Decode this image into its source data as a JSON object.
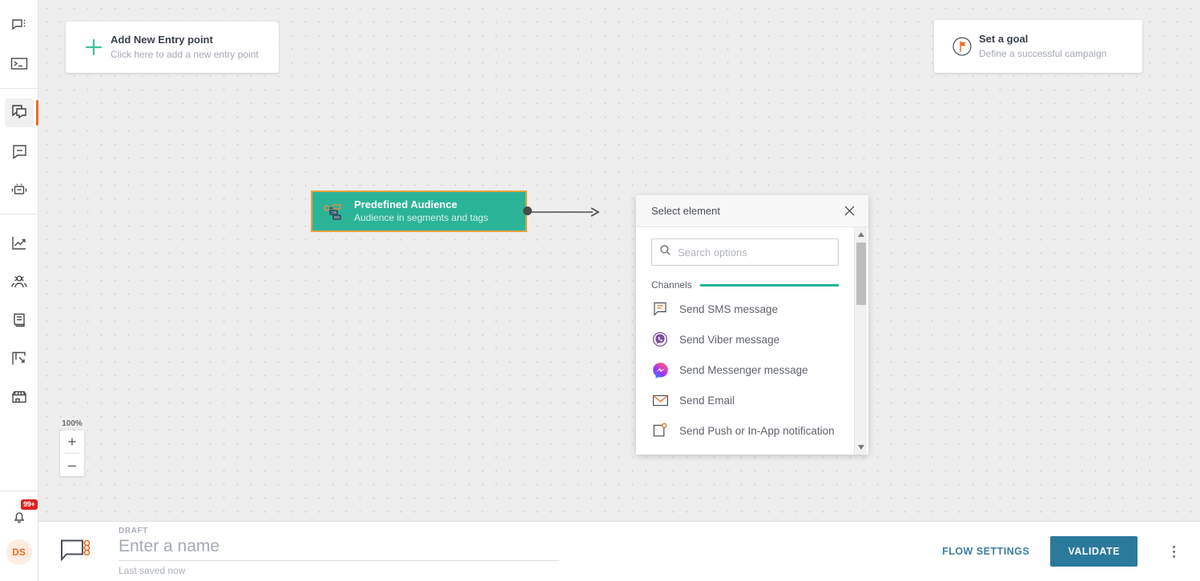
{
  "sidebar": {
    "groups": [
      {
        "items": [
          {
            "name": "chat-menu-icon",
            "icon": "chat-menu"
          },
          {
            "name": "terminal-icon",
            "icon": "terminal"
          }
        ]
      },
      {
        "items": [
          {
            "name": "flows-icon",
            "icon": "flows",
            "active": true
          },
          {
            "name": "templates-icon",
            "icon": "templates"
          },
          {
            "name": "bot-icon",
            "icon": "bot"
          }
        ]
      },
      {
        "items": [
          {
            "name": "analytics-icon",
            "icon": "analytics"
          },
          {
            "name": "audience-icon",
            "icon": "audience"
          },
          {
            "name": "content-icon",
            "icon": "content"
          },
          {
            "name": "pages-icon",
            "icon": "pages"
          },
          {
            "name": "store-icon",
            "icon": "store"
          }
        ]
      }
    ],
    "notifications": {
      "badge": "99+",
      "icon": "bell-icon"
    },
    "avatar_initials": "DS"
  },
  "canvas": {
    "entry_card": {
      "title": "Add New Entry point",
      "subtitle": "Click here to add a new entry point",
      "icon": "plus-icon"
    },
    "goal_card": {
      "title": "Set a goal",
      "subtitle": "Define a successful campaign",
      "icon": "flag-circle-icon"
    },
    "node": {
      "title": "Predefined Audience",
      "subtitle": "Audience in segments and tags",
      "icon": "audience-segments-icon"
    },
    "zoom": {
      "level": "100%",
      "zoom_in_label": "+",
      "zoom_out_label": "–"
    }
  },
  "panel": {
    "title": "Select element",
    "close_icon": "close-icon",
    "search": {
      "placeholder": "Search options",
      "value": "",
      "icon": "search-icon"
    },
    "section": {
      "label": "Channels",
      "accent": "#1db698"
    },
    "options": [
      {
        "label": "Send SMS message",
        "icon": "sms-icon"
      },
      {
        "label": "Send Viber message",
        "icon": "viber-icon"
      },
      {
        "label": "Send Messenger message",
        "icon": "messenger-icon"
      },
      {
        "label": "Send Email",
        "icon": "email-icon"
      },
      {
        "label": "Send Push or In-App notification",
        "icon": "push-icon"
      }
    ]
  },
  "bottom": {
    "flow_icon": "flow-icon",
    "status": "DRAFT",
    "name_placeholder": "Enter a name",
    "name_value": "",
    "saved_label": "Last saved now",
    "flow_settings_label": "FLOW SETTINGS",
    "validate_label": "VALIDATE",
    "more_icon": "kebab-menu-icon"
  },
  "colors": {
    "node_green": "#2bb498",
    "node_border": "#e8a33d",
    "accent_orange": "#ee6c23",
    "validate_blue": "#2b7a9b",
    "badge_red": "#e02020"
  }
}
